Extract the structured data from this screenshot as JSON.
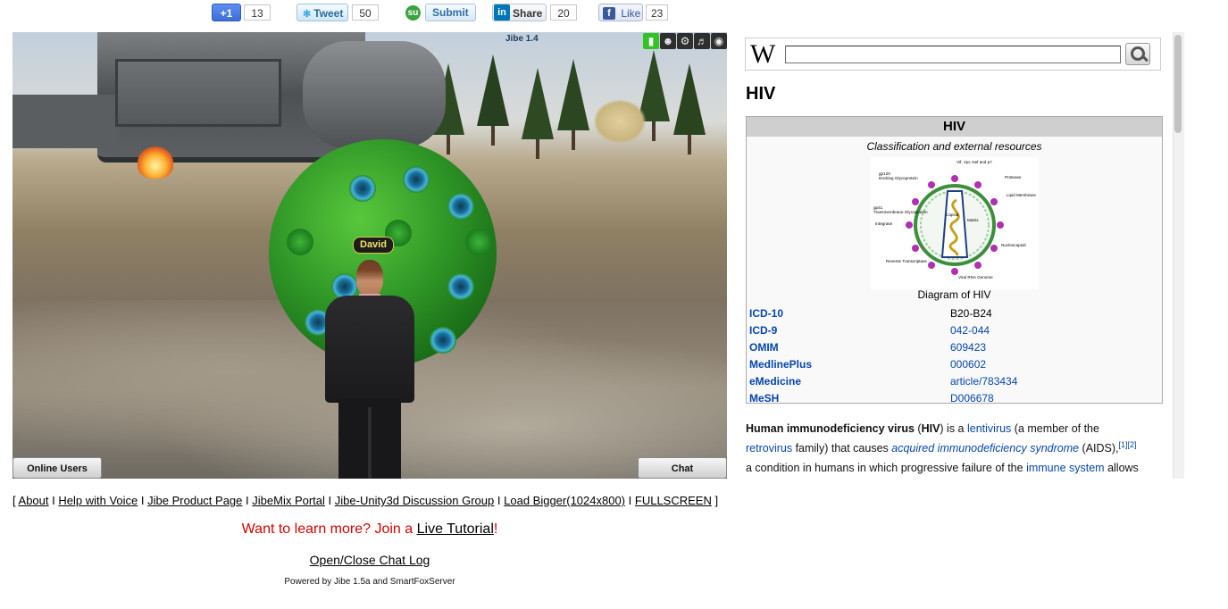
{
  "social": {
    "gplus": {
      "label": "+1",
      "count": "13"
    },
    "tweet": {
      "label": "Tweet",
      "count": "50"
    },
    "stumble": {
      "label": "Submit"
    },
    "linkedin": {
      "label": "Share",
      "count": "20"
    },
    "facebook": {
      "label": "Like",
      "count": "23"
    }
  },
  "game": {
    "version_label": "Jibe 1.4",
    "avatar_name": "David",
    "hud_icons": [
      "battery-icon",
      "user-icon",
      "gear-icon",
      "speaker-icon",
      "globe-icon"
    ],
    "online_users_label": "Online Users",
    "chat_label": "Chat"
  },
  "links": {
    "open_bracket": "[",
    "close_bracket": "]",
    "separator": "I",
    "items": [
      "About",
      "Help with Voice",
      "Jibe Product Page",
      "JibeMix Portal",
      "Jibe-Unity3d Discussion Group",
      "Load Bigger(1024x800)",
      "FULLSCREEN"
    ]
  },
  "promo": {
    "text": "Want to learn more? Join a ",
    "link": "Live Tutorial",
    "suffix": "!"
  },
  "chat_log": "Open/Close Chat Log",
  "powered_by": "Powered by Jibe 1.5a and SmartFoxServer",
  "wiki": {
    "logo": "W",
    "search_value": "",
    "title": "HIV",
    "infobox": {
      "header": "HIV",
      "subheader": "Classification and external resources",
      "diagram_labels": [
        "Vif, Vpr, Nef and p7",
        "gp120",
        "Docking Glycoprotein",
        "Protease",
        "Lipid Membrane",
        "gp41",
        "Transmembrane Glycoprotein",
        "Capsid",
        "Matrix",
        "Integrase",
        "Nucleocapsid",
        "Reverse Transcriptase",
        "Viral RNA Genome"
      ],
      "caption": "Diagram of HIV",
      "rows": [
        {
          "key": "ICD-10",
          "value": "B20-B24",
          "link": false
        },
        {
          "key": "ICD-9",
          "value": "042-044",
          "link": true
        },
        {
          "key": "OMIM",
          "value": "609423",
          "link": true
        },
        {
          "key": "MedlinePlus",
          "value": "000602",
          "link": true
        },
        {
          "key": "eMedicine",
          "value": "article/783434",
          "link": true
        },
        {
          "key": "MeSH",
          "value": "D006678",
          "link": true
        }
      ]
    },
    "para": {
      "b1": "Human immunodeficiency virus",
      "t1": " (",
      "b2": "HIV",
      "t2": ") is a ",
      "l1": "lentivirus",
      "t3": " (a member of the",
      "l2": "retrovirus",
      "t4": " family) that causes ",
      "l3": "acquired immunodeficiency syndrome",
      "t5": " (AIDS),",
      "sup": "[1][2]",
      "t6": "a condition in humans in which progressive failure of the ",
      "l4": "immune system",
      "t7": " allows"
    }
  }
}
